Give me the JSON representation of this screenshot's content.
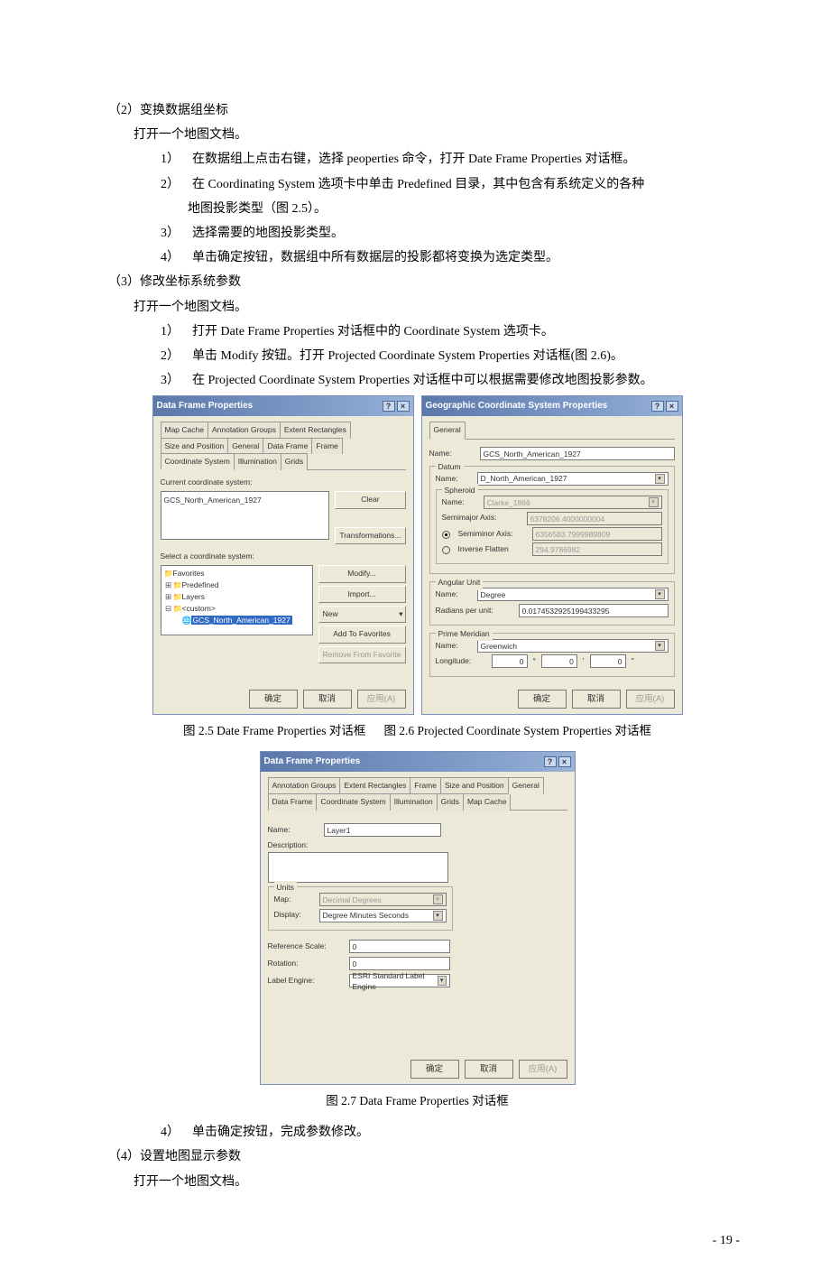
{
  "text": {
    "p2_head": "（2）变换数据组坐标",
    "p2_1": "打开一个地图文档。",
    "p2_1a": "1） 在数据组上点击右键，选择 peoperties 命令，打开 Date Frame Properties 对话框。",
    "p2_2a": "2） 在 Coordinating System 选项卡中单击 Predefined 目录，其中包含有系统定义的各种",
    "p2_2b": "地图投影类型（图 2.5）。",
    "p2_3a": "3） 选择需要的地图投影类型。",
    "p2_4a": "4） 单击确定按钮，数据组中所有数据层的投影都将变换为选定类型。",
    "p3_head": "（3）修改坐标系统参数",
    "p3_1": "打开一个地图文档。",
    "p3_1a": "1） 打开 Date Frame Properties 对话框中的 Coordinate System 选项卡。",
    "p3_2a": "2） 单击 Modify 按钮。打开 Projected Coordinate System Properties 对话框(图 2.6)。",
    "p3_3a": "3） 在 Projected Coordinate System Properties 对话框中可以根据需要修改地图投影参数。",
    "caption25": "图 2.5 Date Frame Properties 对话框",
    "caption26": "图 2.6  Projected Coordinate System Properties 对话框",
    "caption27": "图 2.7  Data Frame Properties 对话框",
    "p3_4a": "4） 单击确定按钮，完成参数修改。",
    "p4_head": "（4）设置地图显示参数",
    "p4_1": "打开一个地图文档。",
    "page_num": "- 19 -"
  },
  "dialog25": {
    "title": "Data Frame Properties",
    "tabs_row1": [
      "Map Cache",
      "Annotation Groups",
      "Extent Rectangles",
      "Size and Position"
    ],
    "tabs_row2": [
      "General",
      "Data Frame",
      "Frame",
      "Coordinate System",
      "Illumination",
      "Grids"
    ],
    "current_label": "Current coordinate system:",
    "current_value": "GCS_North_American_1927",
    "select_label": "Select a coordinate system:",
    "tree": {
      "favorites": "Favorites",
      "predefined": "Predefined",
      "layers": "Layers",
      "custom": "<custom>",
      "selected": "GCS_North_American_1927"
    },
    "buttons": {
      "clear": "Clear",
      "transform": "Transformations...",
      "modify": "Modify...",
      "import": "Import...",
      "new": "New",
      "addfav": "Add To Favorites",
      "remfav": "Remove From Favorite"
    },
    "footer": {
      "ok": "确定",
      "cancel": "取消",
      "apply": "应用(A)"
    }
  },
  "dialog26": {
    "title": "Geographic Coordinate System Properties",
    "tab": "General",
    "name_label": "Name:",
    "name_value": "GCS_North_American_1927",
    "datum": {
      "group": "Datum",
      "name_label": "Name:",
      "name_value": "D_North_American_1927",
      "spheroid": {
        "group": "Spheroid",
        "name_label": "Name:",
        "name_value": "Clarke_1866",
        "semimajor_label": "Semimajor Axis:",
        "semimajor_value": "6378206.4000000004",
        "semiminor_label": "Semiminor Axis:",
        "semiminor_value": "6356583.7999989809",
        "invflat_label": "Inverse Flatten",
        "invflat_value": "294.9786982"
      }
    },
    "angular": {
      "group": "Angular Unit",
      "name_label": "Name:",
      "name_value": "Degree",
      "radians_label": "Radians per unit:",
      "radians_value": "0.0174532925199433295"
    },
    "prime": {
      "group": "Prime Meridian",
      "name_label": "Name:",
      "name_value": "Greenwich",
      "long_label": "Longitude:",
      "d": "0",
      "m": "0",
      "s": "0"
    },
    "footer": {
      "ok": "确定",
      "cancel": "取消",
      "apply": "应用(A)"
    }
  },
  "dialog27": {
    "title": "Data Frame Properties",
    "tabs_row1": [
      "Annotation Groups",
      "Extent Rectangles",
      "Frame",
      "Size and Position"
    ],
    "tabs_row2": [
      "General",
      "Data Frame",
      "Coordinate System",
      "Illumination",
      "Grids",
      "Map Cache"
    ],
    "name_label": "Name:",
    "name_value": "Layer1",
    "desc_label": "Description:",
    "units": {
      "group": "Units",
      "map_label": "Map:",
      "map_value": "Decimal Degrees",
      "display_label": "Display:",
      "display_value": "Degree Minutes Seconds"
    },
    "refscale_label": "Reference Scale:",
    "refscale_value": "0",
    "rotation_label": "Rotation:",
    "rotation_value": "0",
    "labeleng_label": "Label Engine:",
    "labeleng_value": "ESRI Standard Label Engine",
    "footer": {
      "ok": "确定",
      "cancel": "取消",
      "apply": "应用(A)"
    }
  }
}
